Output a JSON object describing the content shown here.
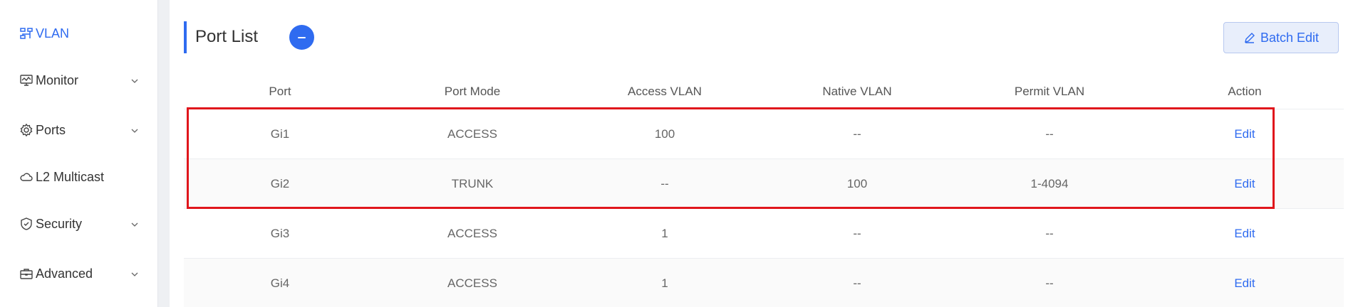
{
  "sidebar": {
    "items": [
      {
        "label": "VLAN",
        "icon": "vlan-icon",
        "active": true,
        "expandable": false
      },
      {
        "label": "Monitor",
        "icon": "monitor-icon",
        "active": false,
        "expandable": true
      },
      {
        "label": "Ports",
        "icon": "gear-icon",
        "active": false,
        "expandable": true
      },
      {
        "label": "L2 Multicast",
        "icon": "cloud-icon",
        "active": false,
        "expandable": false
      },
      {
        "label": "Security",
        "icon": "shield-icon",
        "active": false,
        "expandable": true
      },
      {
        "label": "Advanced",
        "icon": "toolbox-icon",
        "active": false,
        "expandable": true
      }
    ]
  },
  "main": {
    "title": "Port List",
    "batch_edit_label": "Batch Edit"
  },
  "table": {
    "columns": [
      "Port",
      "Port Mode",
      "Access VLAN",
      "Native VLAN",
      "Permit VLAN",
      "Action"
    ],
    "rows": [
      {
        "port": "Gi1",
        "mode": "ACCESS",
        "access": "100",
        "native": "--",
        "permit": "--",
        "action": "Edit"
      },
      {
        "port": "Gi2",
        "mode": "TRUNK",
        "access": "--",
        "native": "100",
        "permit": "1-4094",
        "action": "Edit"
      },
      {
        "port": "Gi3",
        "mode": "ACCESS",
        "access": "1",
        "native": "--",
        "permit": "--",
        "action": "Edit"
      },
      {
        "port": "Gi4",
        "mode": "ACCESS",
        "access": "1",
        "native": "--",
        "permit": "--",
        "action": "Edit"
      }
    ]
  },
  "colors": {
    "accent": "#2f6bf0",
    "highlight": "#e0161c"
  }
}
